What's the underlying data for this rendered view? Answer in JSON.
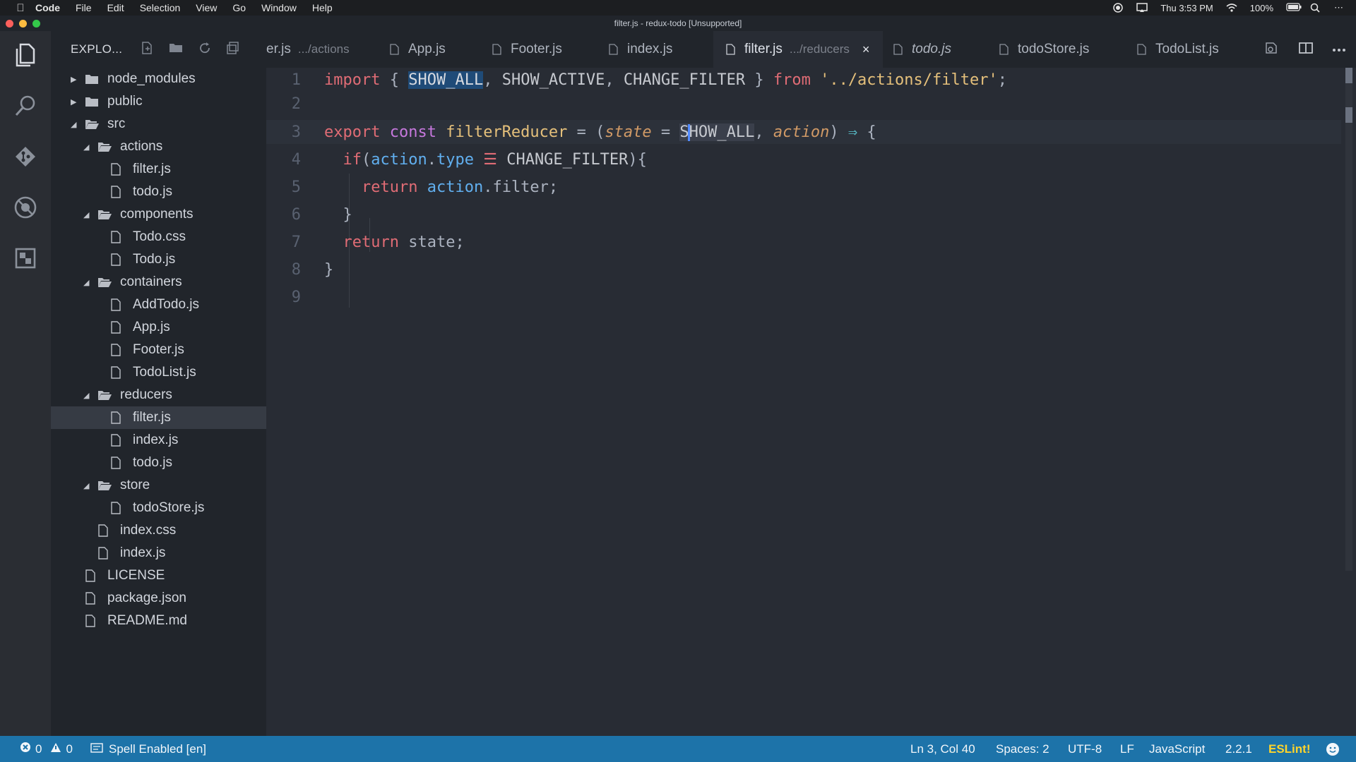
{
  "menubar": {
    "app": "Code",
    "items": [
      "File",
      "Edit",
      "Selection",
      "View",
      "Go",
      "Window",
      "Help"
    ],
    "time": "Thu 3:53 PM",
    "battery": "100%"
  },
  "window": {
    "title": "filter.js - redux-todo [Unsupported]"
  },
  "sidebar": {
    "title": "EXPLO...",
    "tree": [
      {
        "label": "node_modules",
        "type": "folder",
        "depth": 0,
        "state": "collapsed"
      },
      {
        "label": "public",
        "type": "folder",
        "depth": 0,
        "state": "collapsed"
      },
      {
        "label": "src",
        "type": "folder",
        "depth": 0,
        "state": "expanded"
      },
      {
        "label": "actions",
        "type": "folder",
        "depth": 1,
        "state": "expanded"
      },
      {
        "label": "filter.js",
        "type": "file",
        "depth": 2
      },
      {
        "label": "todo.js",
        "type": "file",
        "depth": 2
      },
      {
        "label": "components",
        "type": "folder",
        "depth": 1,
        "state": "expanded"
      },
      {
        "label": "Todo.css",
        "type": "file",
        "depth": 2
      },
      {
        "label": "Todo.js",
        "type": "file",
        "depth": 2
      },
      {
        "label": "containers",
        "type": "folder",
        "depth": 1,
        "state": "expanded"
      },
      {
        "label": "AddTodo.js",
        "type": "file",
        "depth": 2
      },
      {
        "label": "App.js",
        "type": "file",
        "depth": 2
      },
      {
        "label": "Footer.js",
        "type": "file",
        "depth": 2
      },
      {
        "label": "TodoList.js",
        "type": "file",
        "depth": 2
      },
      {
        "label": "reducers",
        "type": "folder",
        "depth": 1,
        "state": "expanded"
      },
      {
        "label": "filter.js",
        "type": "file",
        "depth": 2,
        "selected": true
      },
      {
        "label": "index.js",
        "type": "file",
        "depth": 2
      },
      {
        "label": "todo.js",
        "type": "file",
        "depth": 2
      },
      {
        "label": "store",
        "type": "folder",
        "depth": 1,
        "state": "expanded"
      },
      {
        "label": "todoStore.js",
        "type": "file",
        "depth": 2
      },
      {
        "label": "index.css",
        "type": "file",
        "depth": 1
      },
      {
        "label": "index.js",
        "type": "file",
        "depth": 1
      },
      {
        "label": "LICENSE",
        "type": "file",
        "depth": 0
      },
      {
        "label": "package.json",
        "type": "file",
        "depth": 0
      },
      {
        "label": "README.md",
        "type": "file",
        "depth": 0
      }
    ]
  },
  "tabs": [
    {
      "label": "er.js",
      "hint": ".../actions"
    },
    {
      "label": "App.js"
    },
    {
      "label": "Footer.js"
    },
    {
      "label": "index.js"
    },
    {
      "label": "filter.js",
      "hint": ".../reducers",
      "active": true,
      "close": "×"
    },
    {
      "label": "todo.js",
      "italic": true
    },
    {
      "label": "todoStore.js"
    },
    {
      "label": "TodoList.js"
    }
  ],
  "editor": {
    "line_numbers": [
      "1",
      "2",
      "3",
      "4",
      "5",
      "6",
      "7",
      "8",
      "9"
    ],
    "current_line": 3
  },
  "statusbar": {
    "errors": "0",
    "warnings": "0",
    "spell": "Spell Enabled [en]",
    "position": "Ln 3, Col 40",
    "spaces": "Spaces: 2",
    "encoding": "UTF-8",
    "eol": "LF",
    "language": "JavaScript",
    "version": "2.2.1",
    "eslint": "ESLint!"
  },
  "colors": {
    "statusbar": "#1d73a9",
    "editor_bg": "#282c34",
    "sidebar_bg": "#21252b",
    "selection": "#1f4b78",
    "eslint": "#ffd42b"
  }
}
